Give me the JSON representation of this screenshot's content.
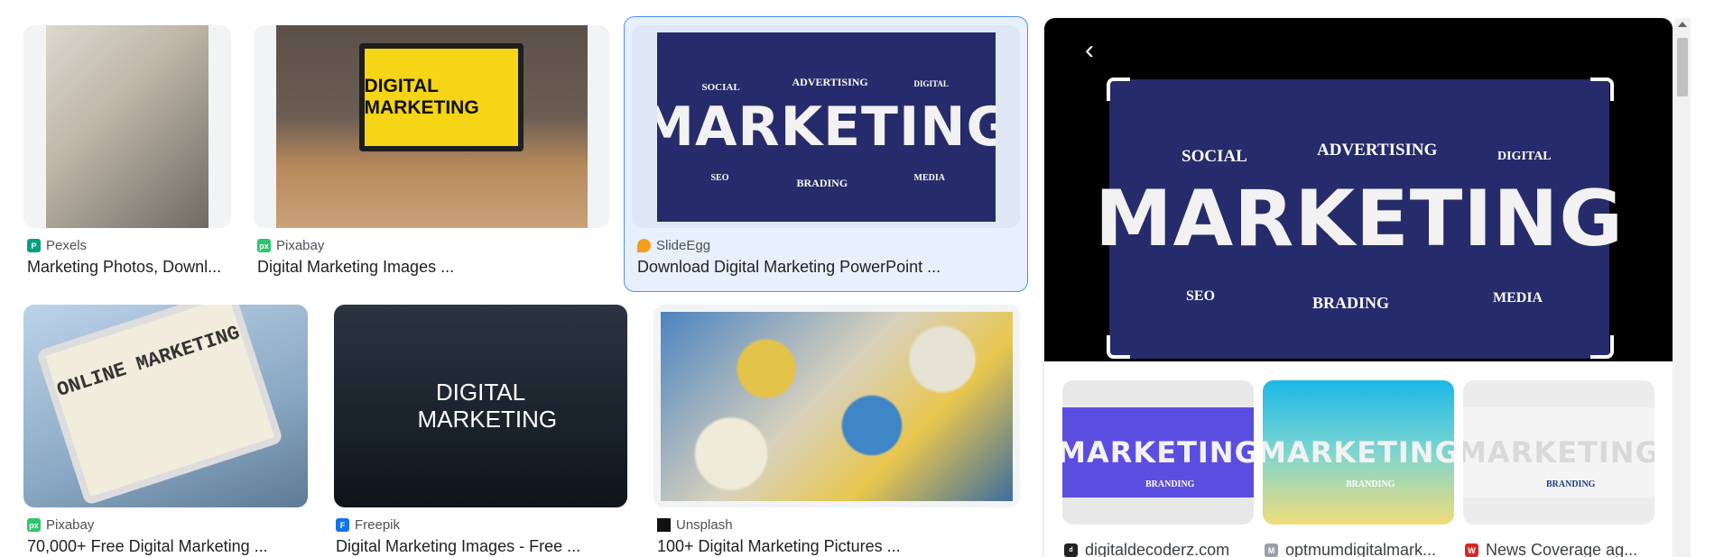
{
  "results": [
    {
      "source": "Pexels",
      "title": "Marketing Photos, Downl...",
      "favicon_color": "#05a081"
    },
    {
      "source": "Pixabay",
      "title": "Digital Marketing Images ...",
      "favicon_color": "#2ec66d",
      "image_text": "DIGITAL MARKETING"
    },
    {
      "source": "SlideEgg",
      "title": "Download Digital Marketing PowerPoint ...",
      "favicon_color": "#f59e1a"
    },
    {
      "source": "Pixabay",
      "title": "70,000+ Free Digital Marketing ...",
      "favicon_color": "#2ec66d",
      "image_text": "ONLINE MARKETING"
    },
    {
      "source": "Freepik",
      "title": "Digital Marketing Images - Free ...",
      "favicon_color": "#1273eb",
      "image_text": "DIGITAL MARKETING"
    },
    {
      "source": "Unsplash",
      "title": "100+ Digital Marketing Pictures ...",
      "favicon_color": "#111111"
    }
  ],
  "marketing_image": {
    "word": "MARKETING",
    "labels": {
      "social": "SOCIAL",
      "advertising": "ADVERTISING",
      "digital": "DIGITAL",
      "seo": "SEO",
      "brading": "BRADING",
      "media": "MEDIA"
    }
  },
  "panel": {
    "back_icon": "chevron-left-icon",
    "related": [
      {
        "source": "digitaldecoderz.com",
        "bg": "#5b4de0",
        "branding": "BRANDING"
      },
      {
        "source": "optmumdigitalmark...",
        "bg": "#27c0e0",
        "branding": "BRANDING"
      },
      {
        "source": "News Coverage ag...",
        "bg": "#eeeeee",
        "branding": "BRANDING"
      }
    ]
  },
  "colors": {
    "selected_border": "#4c8df6",
    "selected_bg": "#e8f0fe",
    "marketing_bg": "#262b6b"
  }
}
